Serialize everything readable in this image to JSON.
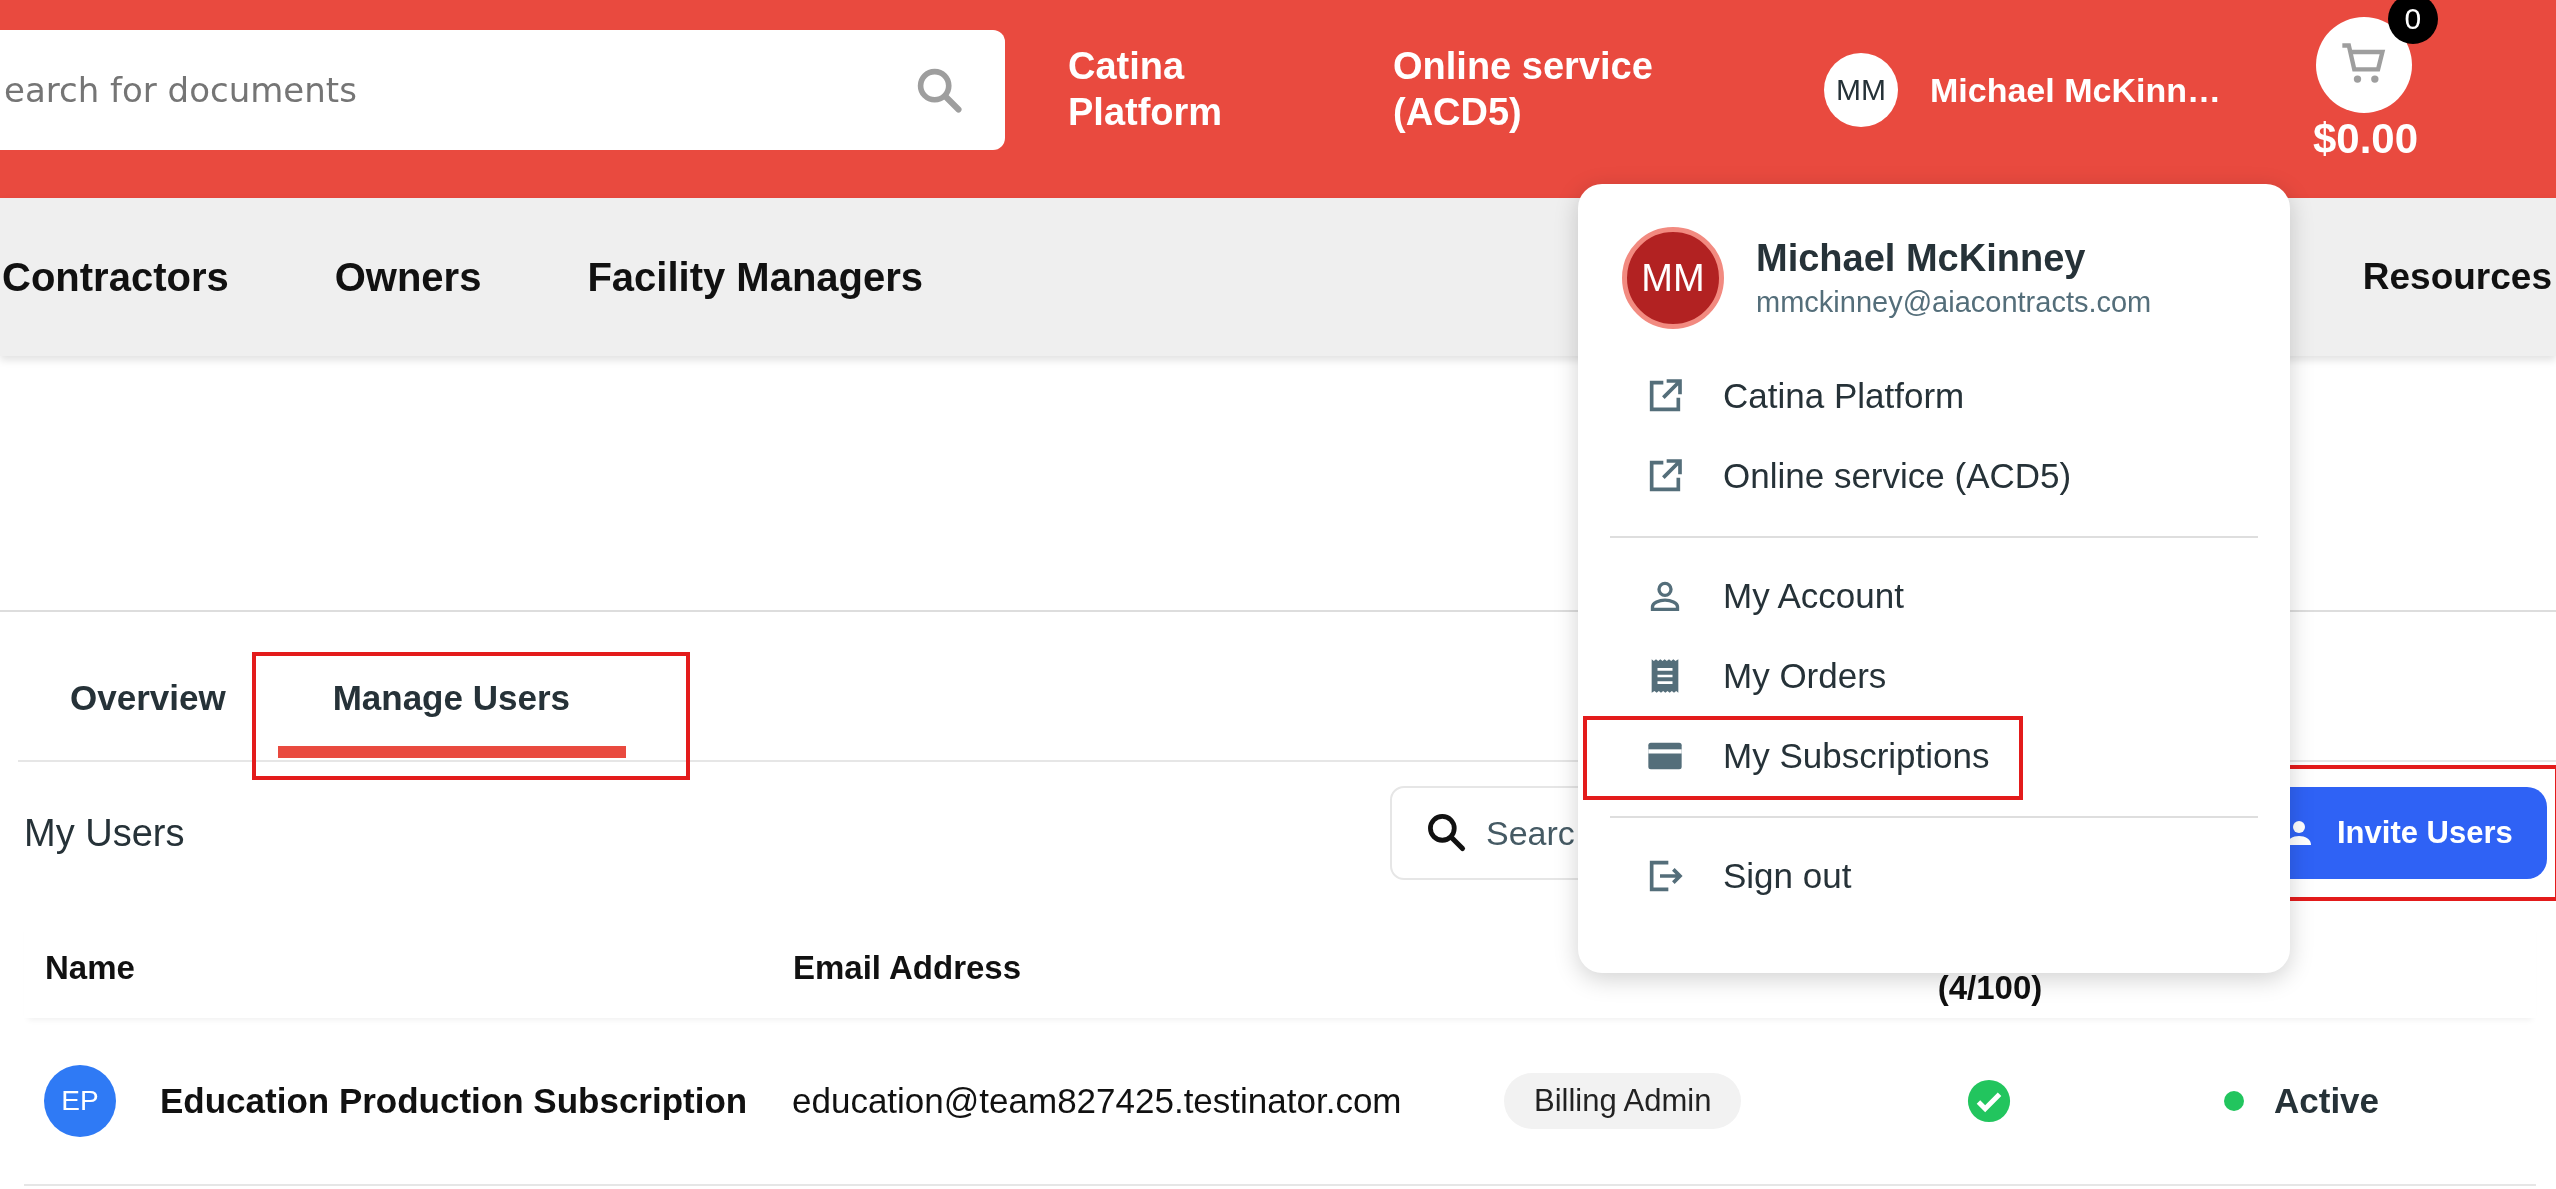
{
  "header": {
    "search": {
      "placeholder": "earch for documents"
    },
    "links": [
      {
        "label": "Catina Platform"
      },
      {
        "label": "Online service (ACD5)"
      }
    ],
    "user": {
      "initials": "MM",
      "name": "Michael McKinn…"
    },
    "cart": {
      "count": "0",
      "total": "$0.00"
    }
  },
  "nav": {
    "items": [
      {
        "label": "Contractors"
      },
      {
        "label": "Owners"
      },
      {
        "label": "Facility Managers"
      },
      {
        "label": "Resources"
      }
    ]
  },
  "tabs": [
    {
      "label": "Overview",
      "selected": false,
      "highlighted": false
    },
    {
      "label": "Manage Users",
      "selected": true,
      "highlighted": true
    }
  ],
  "section_title": "My Users",
  "user_search": {
    "placeholder": "Searc"
  },
  "invite_button": {
    "label": "Invite Users",
    "highlighted": true
  },
  "table": {
    "columns": [
      {
        "label": "Name",
        "kind": "name"
      },
      {
        "label": "Email Address",
        "kind": "email"
      },
      {
        "label": "(4/100)",
        "kind": "seats"
      }
    ],
    "rows": [
      {
        "initials": "EP",
        "name": "Education Production Subscription",
        "email": "education@team827425.testinator.com",
        "role": "Billing Admin",
        "assigned": true,
        "status": "Active",
        "color": "#22c55e"
      }
    ]
  },
  "menu": {
    "user": {
      "initials": "MM",
      "name": "Michael McKinney",
      "email": "mmckinney@aiacontracts.com"
    },
    "groups": [
      [
        {
          "kind": "external",
          "label": "Catina Platform",
          "highlighted": false
        },
        {
          "kind": "external",
          "label": "Online service (ACD5)",
          "highlighted": false
        }
      ],
      [
        {
          "kind": "person",
          "label": "My Account",
          "highlighted": false
        },
        {
          "kind": "receipt",
          "label": "My Orders",
          "highlighted": false
        },
        {
          "kind": "card",
          "label": "My Subscriptions",
          "highlighted": true
        }
      ],
      [
        {
          "kind": "signout",
          "label": "Sign out",
          "highlighted": false
        }
      ]
    ]
  }
}
